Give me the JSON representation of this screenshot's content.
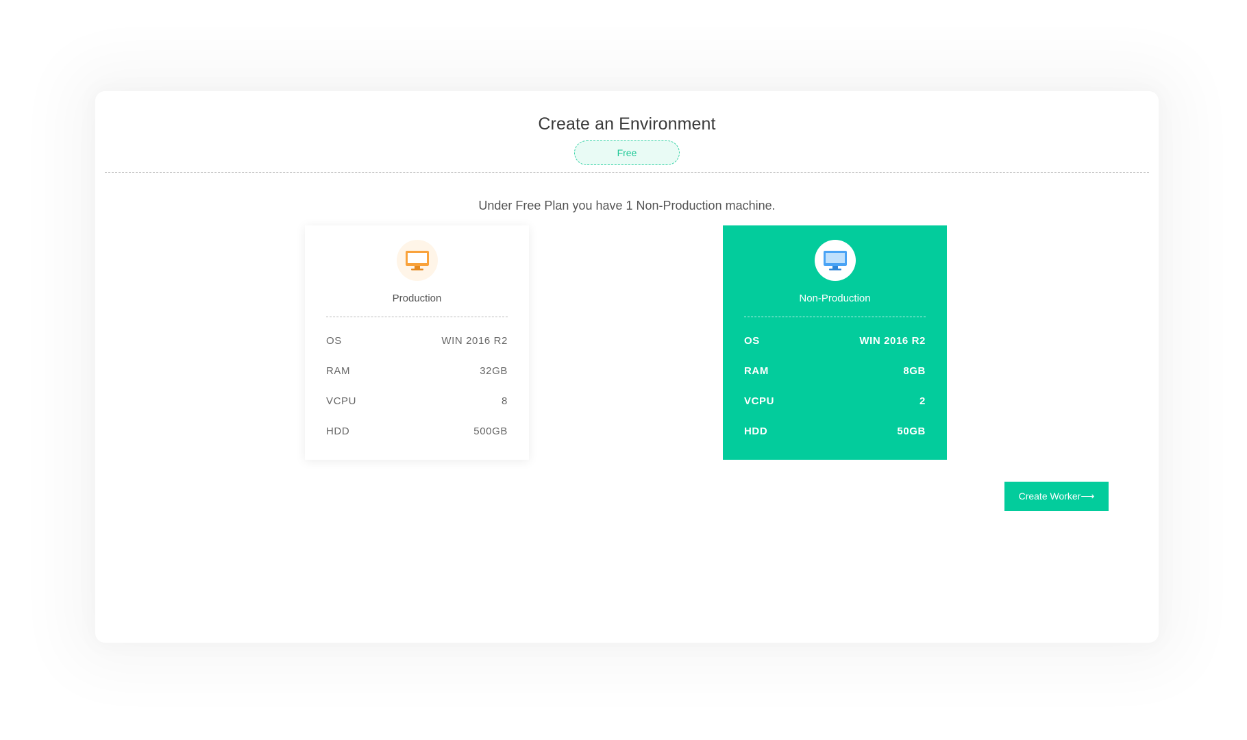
{
  "header": {
    "title": "Create an Environment",
    "plan_badge": "Free"
  },
  "subtitle": "Under Free Plan you have 1 Non-Production machine.",
  "cards": [
    {
      "name": "Production",
      "icon": "monitor-icon",
      "icon_color": "#f9a23b",
      "selected": false,
      "specs": [
        {
          "label": "OS",
          "value": "WIN 2016 R2"
        },
        {
          "label": "RAM",
          "value": "32GB"
        },
        {
          "label": "VCPU",
          "value": "8"
        },
        {
          "label": "HDD",
          "value": "500GB"
        }
      ]
    },
    {
      "name": "Non-Production",
      "icon": "monitor-icon",
      "icon_color": "#4aa3f5",
      "selected": true,
      "specs": [
        {
          "label": "OS",
          "value": "WIN 2016 R2"
        },
        {
          "label": "RAM",
          "value": "8GB"
        },
        {
          "label": "VCPU",
          "value": "2"
        },
        {
          "label": "HDD",
          "value": "50GB"
        }
      ]
    }
  ],
  "actions": {
    "create_label": "Create Worker⟶"
  },
  "colors": {
    "accent": "#03cc9c",
    "badge_text": "#1fc896",
    "production_icon": "#f9a23b",
    "nonprod_icon": "#4aa3f5"
  }
}
